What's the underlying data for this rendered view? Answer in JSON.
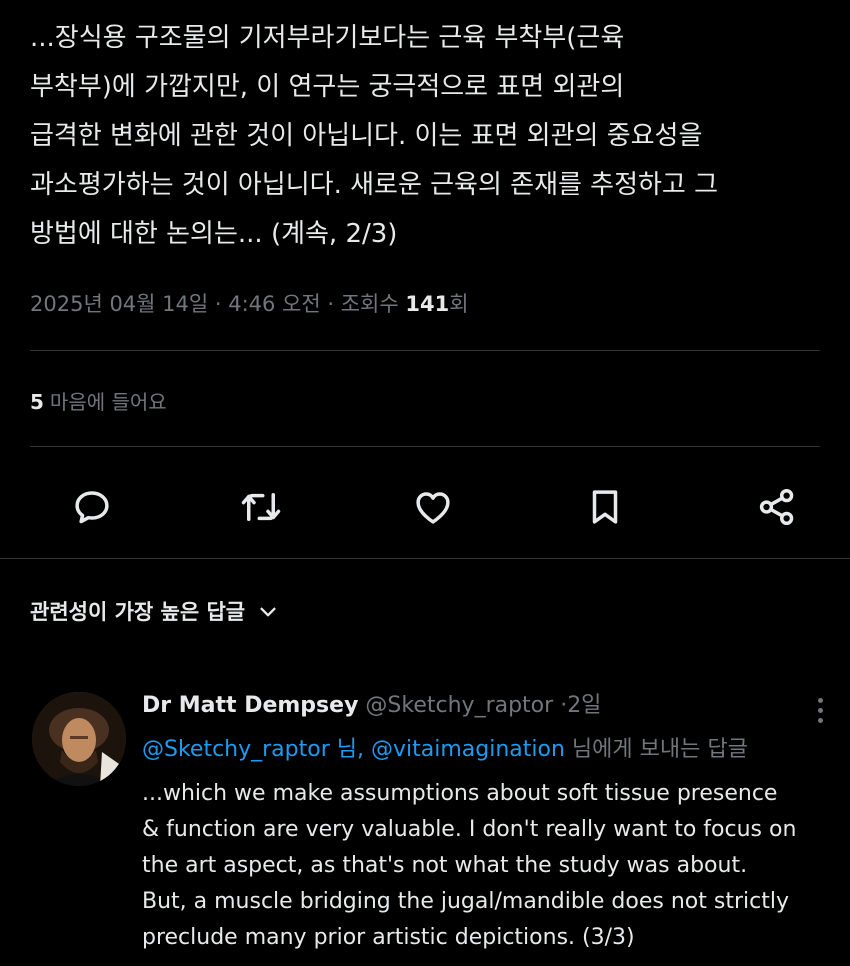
{
  "tweet": {
    "lines": [
      "...장식용 구조물의 기저부라기보다는 근육 부착부(근육",
      "부착부)에 가깝지만, 이 연구는 궁극적으로 표면 외관의",
      "급격한 변화에 관한 것이 아닙니다. 이는 표면 외관의 중요성을",
      "과소평가하는 것이 아닙니다. 새로운 근육의 존재를 추정하고 그",
      "방법에 대한 논의는... (계속, 2/3)"
    ],
    "date_time": "2025년 04월 14일 · 4:46 오전 · 조회수 ",
    "views_count": "141",
    "views_suffix": "회",
    "likes_count": "5",
    "likes_label": "마음에 들어요"
  },
  "actions": {
    "reply_icon": "reply-bubble-icon",
    "retweet_icon": "retweet-icon",
    "like_icon": "heart-icon",
    "bookmark_icon": "bookmark-icon",
    "share_icon": "share-icon"
  },
  "replies_sort": {
    "label": "관련성이 가장 높은 답글"
  },
  "reply": {
    "author": "Dr Matt Dempsey",
    "handle": "@Sketchy_raptor",
    "dot": "·",
    "time": "2일",
    "mention_1": "@Sketchy_raptor 님,",
    "mention_2": "@vitaimagination",
    "replying_suffix": "님에게 보내는 답글",
    "lines": [
      "...which we make assumptions about soft tissue presence",
      "& function are very valuable. I don't really want to focus on",
      "the art aspect, as that's not what the study was about.",
      "But, a muscle bridging the jugal/mandible does not strictly",
      "preclude many prior artistic depictions. (3/3)"
    ]
  },
  "colors": {
    "background": "#000000",
    "text_primary": "#e7e9ea",
    "text_secondary": "#71767b",
    "link": "#1d9bf0",
    "divider": "#2f3336"
  }
}
